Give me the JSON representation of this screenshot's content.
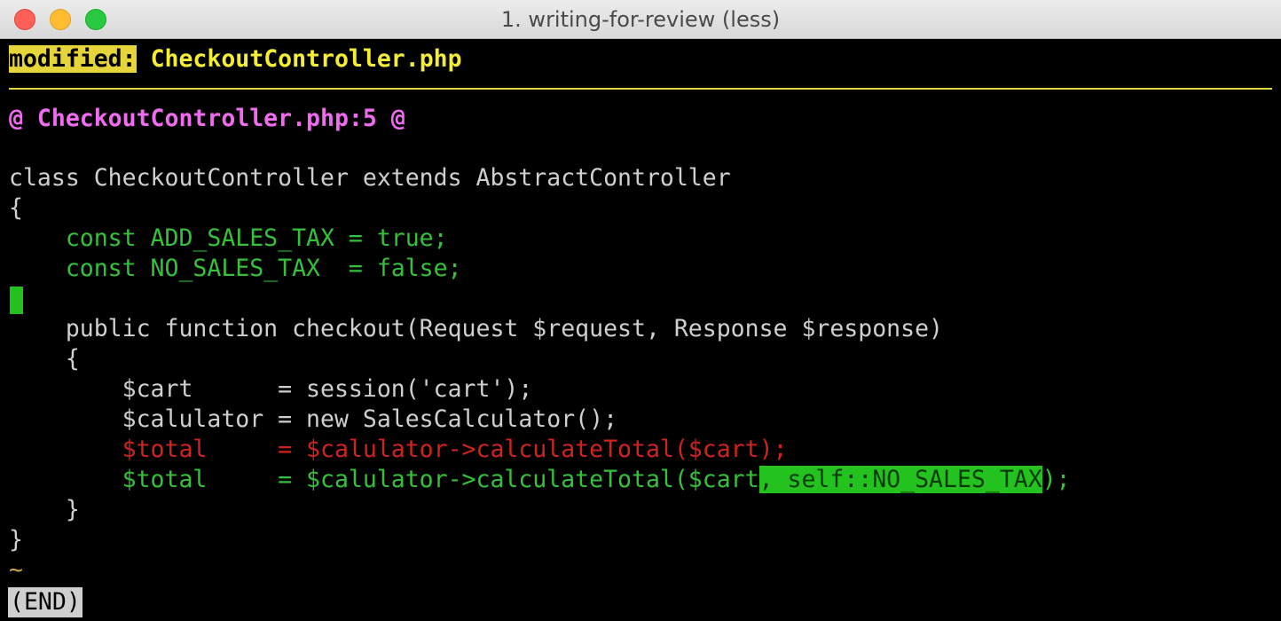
{
  "window": {
    "title": "1. writing-for-review (less)"
  },
  "diff": {
    "file_status": "modified:",
    "file_name": "CheckoutController.php",
    "hunk_header": "@ CheckoutController.php:5 @",
    "lines": {
      "class_decl": "class CheckoutController extends AbstractController",
      "class_open": "{",
      "const_add": "    const ADD_SALES_TAX = true;",
      "const_no": "    const NO_SALES_TAX  = false;",
      "func_decl": "    public function checkout(Request $request, Response $response)",
      "func_open": "    {",
      "cart": "        $cart      = session('cart');",
      "calc": "        $calulator = new SalesCalculator();",
      "removed_total": "        $total     = $calulator->calculateTotal($cart);",
      "added_total_pre": "        $total     = $calulator->calculateTotal($cart",
      "added_total_hl": ", self::NO_SALES_TAX",
      "added_total_post": ");",
      "func_close": "    }",
      "class_close": "}"
    },
    "tilde": "~",
    "end_marker": "(END)"
  },
  "colors": {
    "modified_tag_bg": "#e6d53a",
    "file_name": "#f4ed35",
    "hunk": "#f16bf0",
    "context": "#cfcfcf",
    "added": "#34c23a",
    "removed": "#d0231e",
    "added_highlight_bg": "#23c21f"
  }
}
